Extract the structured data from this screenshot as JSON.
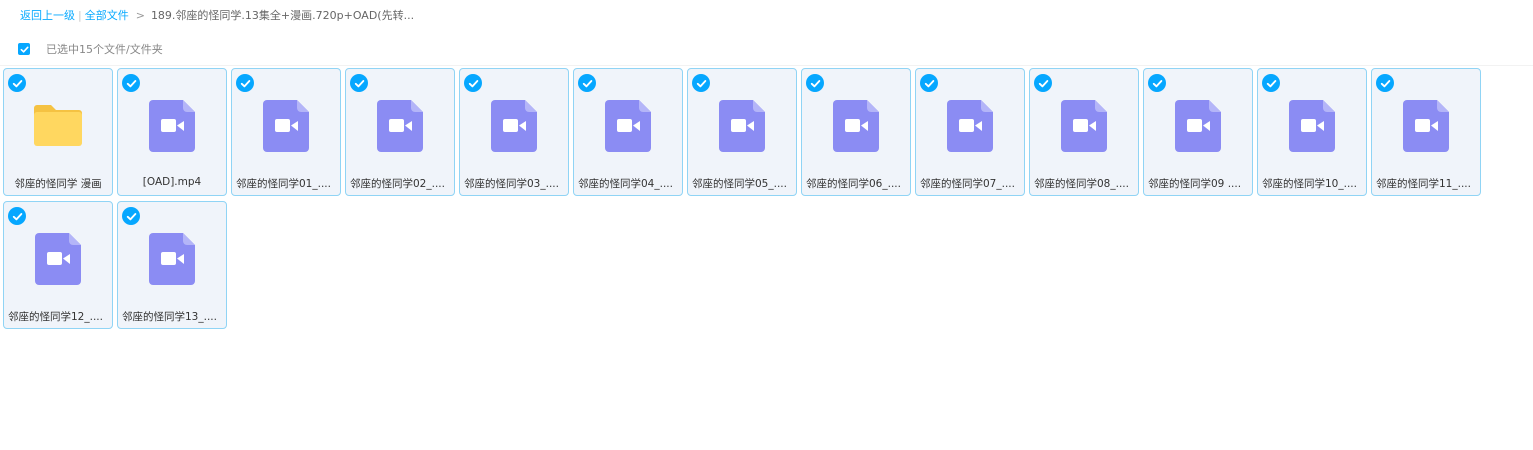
{
  "breadcrumb": {
    "back_label": "返回上一级",
    "all_files_label": "全部文件",
    "separator": ">",
    "current_label": "189.邻座的怪同学.13集全+漫画.720p+OAD(先转..."
  },
  "selection": {
    "text": "已选中15个文件/文件夹"
  },
  "colors": {
    "accent": "#06a7ff",
    "video_icon": "#8b8cf3",
    "folder_icon": "#ffd760"
  },
  "files": [
    {
      "name": "邻座的怪同学 漫画",
      "icon": "folder-icon"
    },
    {
      "name": "[OAD].mp4",
      "icon": "video-file-icon"
    },
    {
      "name": "邻座的怪同学01_....",
      "icon": "video-file-icon"
    },
    {
      "name": "邻座的怪同学02_....",
      "icon": "video-file-icon"
    },
    {
      "name": "邻座的怪同学03_....",
      "icon": "video-file-icon"
    },
    {
      "name": "邻座的怪同学04_....",
      "icon": "video-file-icon"
    },
    {
      "name": "邻座的怪同学05_....",
      "icon": "video-file-icon"
    },
    {
      "name": "邻座的怪同学06_....",
      "icon": "video-file-icon"
    },
    {
      "name": "邻座的怪同学07_....",
      "icon": "video-file-icon"
    },
    {
      "name": "邻座的怪同学08_....",
      "icon": "video-file-icon"
    },
    {
      "name": "邻座的怪同学09 ....",
      "icon": "video-file-icon"
    },
    {
      "name": "邻座的怪同学10_....",
      "icon": "video-file-icon"
    },
    {
      "name": "邻座的怪同学11_....",
      "icon": "video-file-icon"
    },
    {
      "name": "邻座的怪同学12_....",
      "icon": "video-file-icon"
    },
    {
      "name": "邻座的怪同学13_....",
      "icon": "video-file-icon"
    }
  ]
}
